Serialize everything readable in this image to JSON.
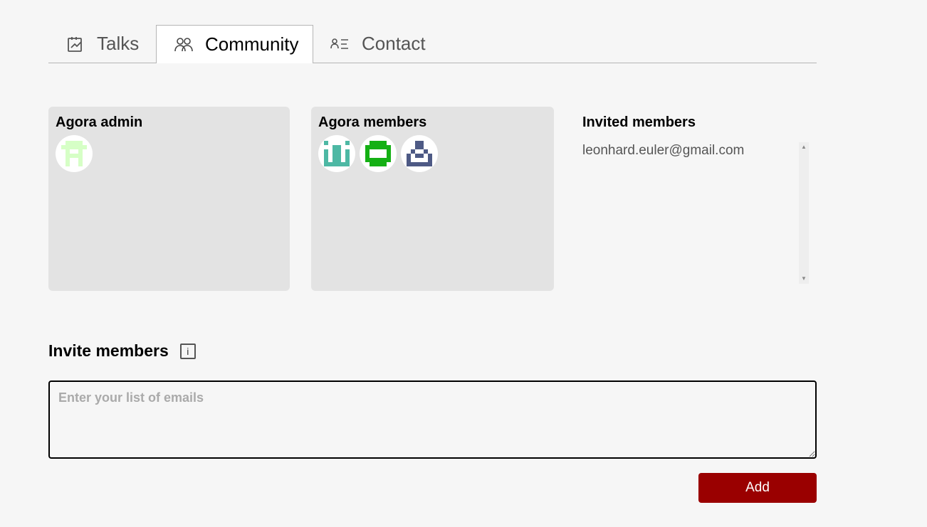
{
  "tabs": [
    {
      "label": "Talks",
      "icon": "talks-icon"
    },
    {
      "label": "Community",
      "icon": "community-icon",
      "active": true
    },
    {
      "label": "Contact",
      "icon": "contact-icon"
    }
  ],
  "admin": {
    "title": "Agora admin",
    "avatars": [
      {
        "icon": "identicon-admin",
        "color": "#d6ffc6"
      }
    ]
  },
  "members": {
    "title": "Agora members",
    "avatars": [
      {
        "icon": "identicon-member-1",
        "color": "#4db8a4"
      },
      {
        "icon": "identicon-member-2",
        "color": "#14b014"
      },
      {
        "icon": "identicon-member-3",
        "color": "#4e5a85"
      }
    ]
  },
  "invited": {
    "title": "Invited members",
    "emails": [
      "leonhard.euler@gmail.com"
    ]
  },
  "invite": {
    "title": "Invite members",
    "placeholder": "Enter your list of emails",
    "value": "",
    "add_label": "Add"
  },
  "colors": {
    "background": "#f6f6f6",
    "card": "#e3e3e3",
    "accent": "#9a0000"
  }
}
